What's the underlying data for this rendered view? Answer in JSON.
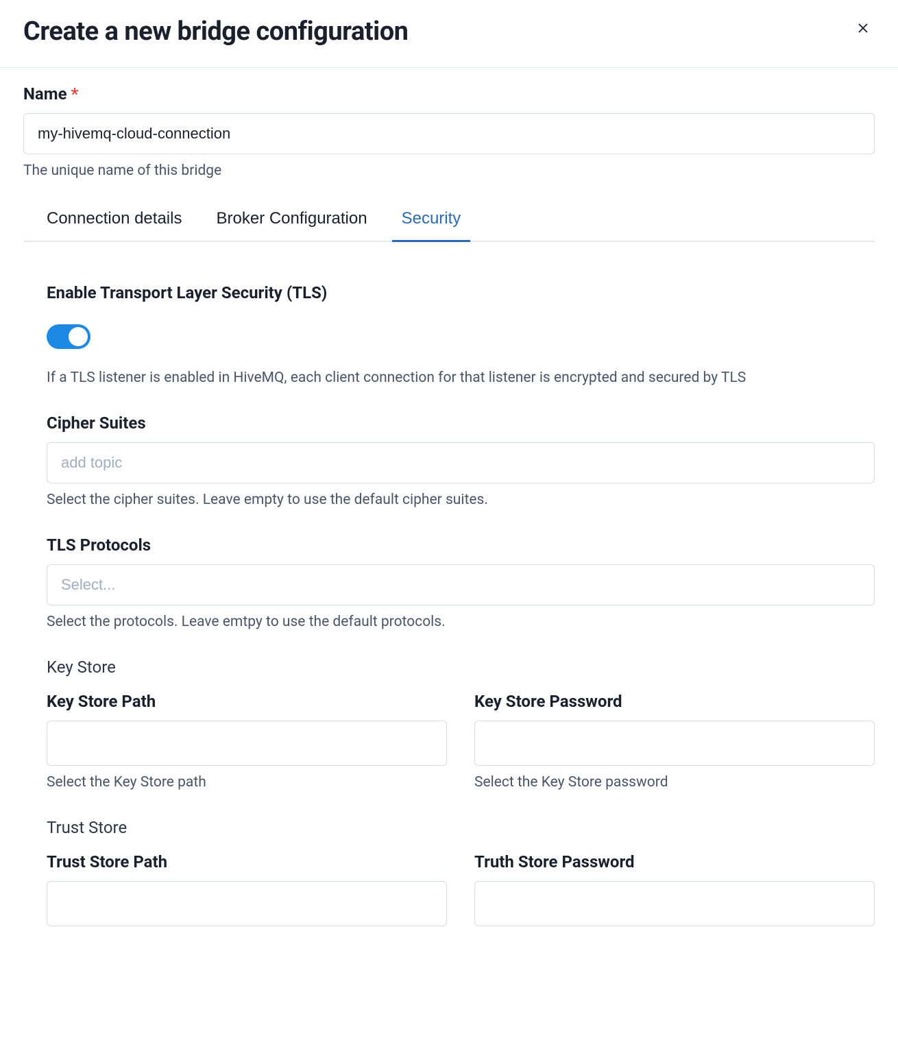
{
  "header": {
    "title": "Create a new bridge configuration"
  },
  "name_field": {
    "label": "Name",
    "value": "my-hivemq-cloud-connection",
    "helper": "The unique name of this bridge"
  },
  "tabs": {
    "connection": "Connection details",
    "broker": "Broker Configuration",
    "security": "Security"
  },
  "security": {
    "tls": {
      "label": "Enable Transport Layer Security (TLS)",
      "helper": "If a TLS listener is enabled in HiveMQ, each client connection for that listener is encrypted and secured by TLS"
    },
    "cipher_suites": {
      "label": "Cipher Suites",
      "placeholder": "add topic",
      "helper": "Select the cipher suites. Leave empty to use the default cipher suites."
    },
    "tls_protocols": {
      "label": "TLS Protocols",
      "placeholder": "Select...",
      "helper": "Select the protocols. Leave emtpy to use the default protocols."
    },
    "key_store": {
      "heading": "Key Store",
      "path_label": "Key Store Path",
      "path_helper": "Select the Key Store path",
      "password_label": "Key Store Password",
      "password_helper": "Select the Key Store password"
    },
    "trust_store": {
      "heading": "Trust Store",
      "path_label": "Trust Store Path",
      "password_label": "Truth Store Password"
    }
  }
}
